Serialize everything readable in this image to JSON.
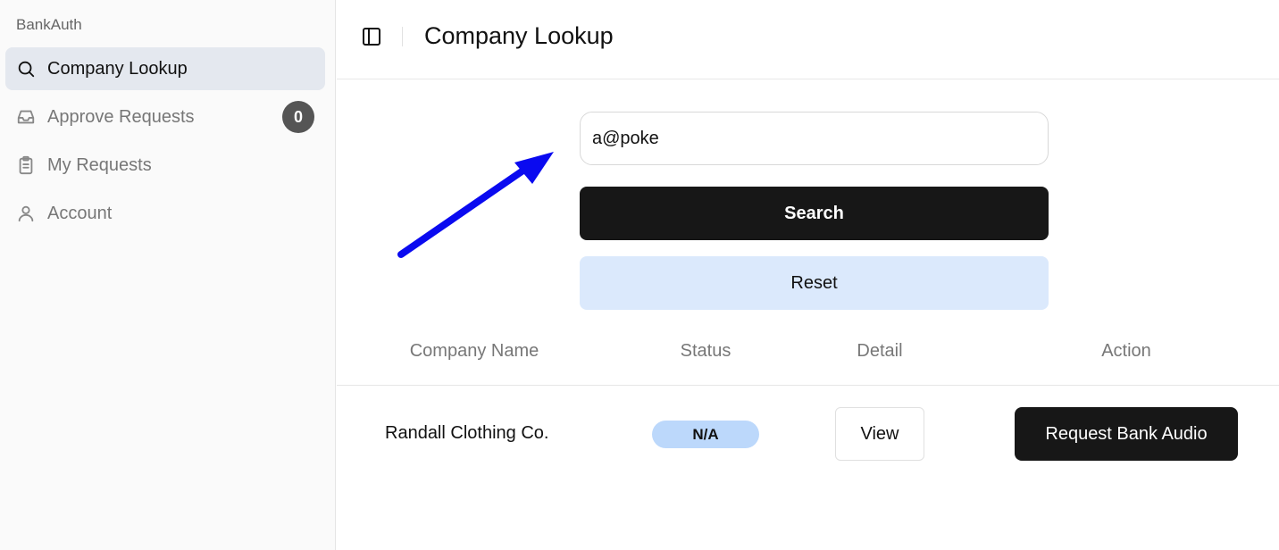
{
  "sidebar": {
    "brand": "BankAuth",
    "items": [
      {
        "label": "Company Lookup",
        "icon": "search-icon",
        "active": true
      },
      {
        "label": "Approve Requests",
        "icon": "inbox-icon",
        "badge": "0"
      },
      {
        "label": "My Requests",
        "icon": "clipboard-icon"
      },
      {
        "label": "Account",
        "icon": "user-icon"
      }
    ]
  },
  "header": {
    "title": "Company Lookup",
    "toggle_icon": "sidebar-toggle-icon"
  },
  "search": {
    "value": "a@poke",
    "search_label": "Search",
    "reset_label": "Reset"
  },
  "table": {
    "headers": [
      "Company Name",
      "Status",
      "Detail",
      "Action"
    ],
    "rows": [
      {
        "company": "Randall Clothing Co.",
        "status": "N/A",
        "detail_label": "View",
        "action_label": "Request Bank Audio"
      }
    ]
  },
  "colors": {
    "primary": "#171717",
    "reset_bg": "#dbe9fc",
    "status_bg": "#bcd8fb",
    "arrow": "#0a0af0"
  }
}
